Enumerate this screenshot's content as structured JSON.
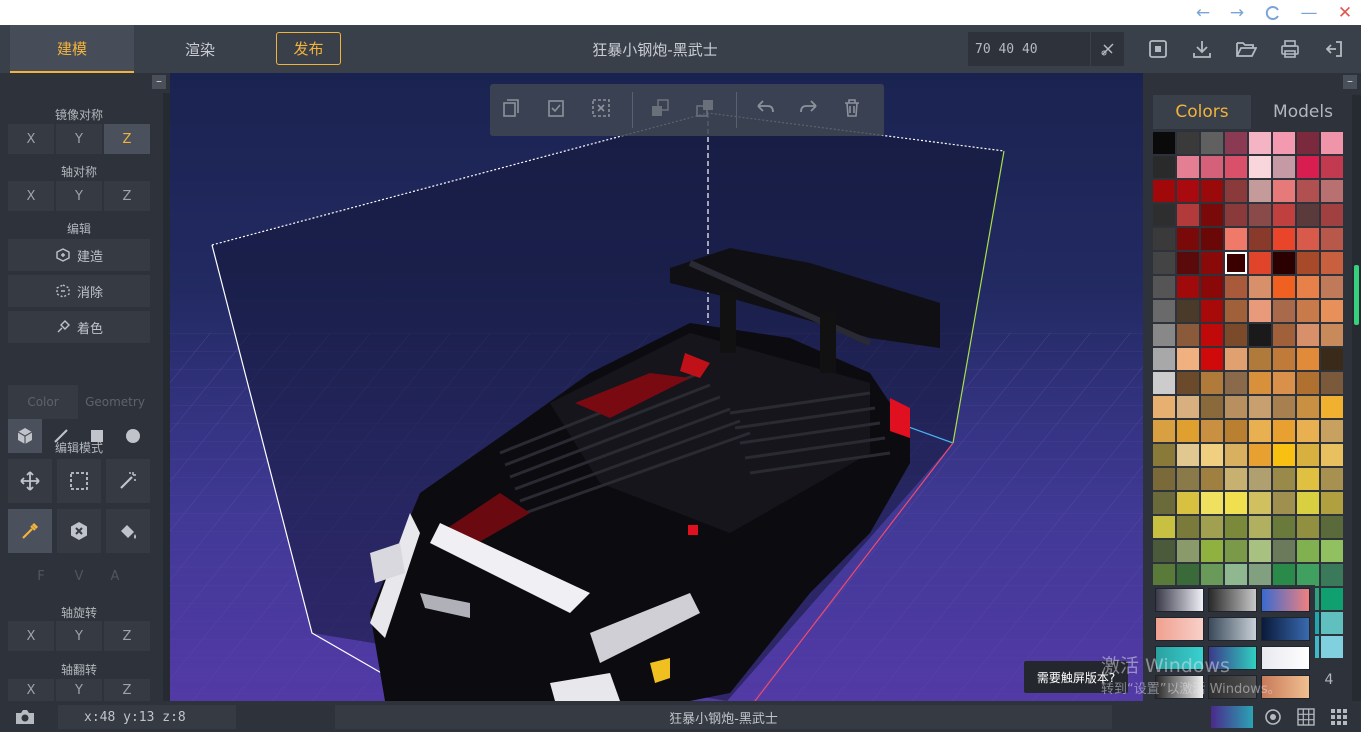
{
  "window": {
    "back": "←",
    "forward": "→",
    "refresh": "C",
    "minimize": "—",
    "close": "✕"
  },
  "topbar": {
    "tab_model": "建模",
    "tab_render": "渲染",
    "publish": "发布",
    "title": "狂暴小钢炮-黑武士",
    "dimensions": "70 40 40"
  },
  "left": {
    "collapse": "–",
    "mirror_title": "镜像对称",
    "mirror_axes": [
      "X",
      "Y",
      "Z"
    ],
    "mirror_active": "Z",
    "axis_sym_title": "轴对称",
    "axis_sym_axes": [
      "X",
      "Y",
      "Z"
    ],
    "edit_title": "编辑",
    "build": "建造",
    "erase": "消除",
    "paint": "着色",
    "mode_color": "Color",
    "mode_geometry": "Geometry",
    "edit_mode_title": "编辑模式",
    "fva": [
      "F",
      "V",
      "A"
    ],
    "rotate_title": "轴旋转",
    "rotate_axes": [
      "X",
      "Y",
      "Z"
    ],
    "flip_title": "轴翻转",
    "flip_axes": [
      "X",
      "Y",
      "Z"
    ]
  },
  "right": {
    "collapse": "–",
    "tab_colors": "Colors",
    "tab_models": "Models",
    "watermark_line1": "激活 Windows",
    "watermark_line2": "转到“设置”以激活 Windows。",
    "touch_tip": "需要触屏版本?",
    "brush_size": "4",
    "palette": [
      [
        "#0a0a0a",
        "#3a3a3a",
        "#606060",
        "#8a3a52",
        "#f4b4c4",
        "#f39ab0",
        "#7a2a3c",
        "#f095a9"
      ],
      [
        "#2a2a2a",
        "#e47e93",
        "#d4607a",
        "#d8506a",
        "#f8d6dc",
        "#c69aa4",
        "#d81e50",
        "#c23a50"
      ],
      [
        "#a0080a",
        "#a80a10",
        "#9a0a0a",
        "#8a3a3a",
        "#c49a9a",
        "#e67a7a",
        "#b05050",
        "#b87070"
      ],
      [
        "#2e2e2e",
        "#b23a3a",
        "#7a0a0a",
        "#8a3a3a",
        "#8a4a4a",
        "#c04040",
        "#5a3a3a",
        "#a04040"
      ],
      [
        "#3a3a3a",
        "#7a0a0a",
        "#6a0808",
        "#f07a6a",
        "#8a3a2a",
        "#e8452a",
        "#d85a4a",
        "#b8584a"
      ],
      [
        "#444444",
        "#5a0a0a",
        "#8a0a0a",
        "#3a0000",
        "#e0442a",
        "#2a0000",
        "#a84a2a",
        "#c86040"
      ],
      [
        "#555555",
        "#a00a0a",
        "#8a0808",
        "#a85a3a",
        "#d8906a",
        "#f06020",
        "#e8804a",
        "#c07a5a"
      ],
      [
        "#6a6a6a",
        "#4a3a2a",
        "#a80a0a",
        "#a0603a",
        "#e89a7a",
        "#a86a4a",
        "#c87a4a",
        "#e8905a"
      ],
      [
        "#888888",
        "#8a5a3a",
        "#c00a0a",
        "#7a4a2a",
        "#1a1a1a",
        "#a0603a",
        "#d8906a",
        "#c88a5a"
      ],
      [
        "#a8a8a8",
        "#f0b080",
        "#d00a0a",
        "#e0a070",
        "#b07a3a",
        "#c07a3a",
        "#e08a3a",
        "#3a2a1a"
      ],
      [
        "#cccccc",
        "#6a4a2a",
        "#b07a3a",
        "#8a6a4a",
        "#d8903a",
        "#d8904a",
        "#b07030",
        "#7a5a3a"
      ],
      [
        "#e8b070",
        "#d8b080",
        "#8a6a3a",
        "#b89060",
        "#c8a070",
        "#a88050",
        "#c89040",
        "#f0b030"
      ],
      [
        "#d8a040",
        "#e0a030",
        "#c89040",
        "#b88030",
        "#e8b050",
        "#e8a030",
        "#e8b050",
        "#c8a060"
      ],
      [
        "#8a7a3a",
        "#e0c890",
        "#f0d080",
        "#d8b060",
        "#e8a030",
        "#f8c010",
        "#d8b040",
        "#e8c060"
      ],
      [
        "#7a6a3a",
        "#8a7a4a",
        "#a08040",
        "#c8b070",
        "#b0a070",
        "#9a8a4a",
        "#e0c040",
        "#a89050"
      ],
      [
        "#6a6a3a",
        "#d8c040",
        "#f0e060",
        "#f0e050",
        "#d0c060",
        "#a09050",
        "#d8d040",
        "#b0a040"
      ],
      [
        "#c8c040",
        "#7a7a3a",
        "#a0a050",
        "#7a8a3a",
        "#b0b060",
        "#6a7a3a",
        "#909040",
        "#5a6a3a"
      ],
      [
        "#4a5a3a",
        "#8a9a6a",
        "#90b040",
        "#7a9a4a",
        "#a8c080",
        "#6a7a5a",
        "#80b050",
        "#90c060"
      ],
      [
        "#5a7a3a",
        "#3a6a3a",
        "#6a9a5a",
        "#90b890",
        "#80a080",
        "#2a8a4a",
        "#40a060",
        "#3a7a5a"
      ],
      [
        "#2a5a3a",
        "#3a6a4a",
        "#5a8a6a",
        "#8ab8a0",
        "#30a070",
        "#20a080",
        "#30a080",
        "#10a070"
      ],
      [
        "#2a5a4a",
        "#3a6a5a",
        "#5a9a8a",
        "#6ab8b0",
        "#2aa0a0",
        "#20b0a0",
        "#20a8b0",
        "#60c0c0"
      ],
      [
        "#2a5a5a",
        "#3a7a7a",
        "#3a9a9a",
        "#8ad0d0",
        "#30a0b0",
        "#2ab0c0",
        "#40b8c8",
        "#80d0e0"
      ]
    ],
    "selected_swatch": [
      5,
      3
    ],
    "gradients": [
      "linear-gradient(90deg,#3a3a4a,#f0f0f8)",
      "linear-gradient(90deg,#2a2a2a,#c8c8c8)",
      "linear-gradient(90deg,#3a6ad0,#f08080)",
      "linear-gradient(90deg,#f0a090,#f8d0c8)",
      "linear-gradient(90deg,#3a4a5a,#c8d0d8)",
      "linear-gradient(90deg,#0a1a3a,#3a6ab0)",
      "linear-gradient(90deg,#2aa0a0,#3ad0d0)",
      "linear-gradient(90deg,#3a3a8a,#30d0c0)",
      "linear-gradient(90deg,#e8e8f0,#ffffff)",
      "linear-gradient(90deg,#2a2a2a,#f0f0f0)",
      "linear-gradient(90deg,#303030,#505050)",
      "linear-gradient(90deg,#c87a5a,#f0c090)"
    ]
  },
  "status": {
    "coords": "x:48 y:13 z:8",
    "title": "狂暴小钢炮-黑武士"
  },
  "colors": {
    "accent": "#f2b33c",
    "panel": "#2e333b",
    "toolbar": "#3a404a",
    "selection_green": "#37d07d"
  }
}
